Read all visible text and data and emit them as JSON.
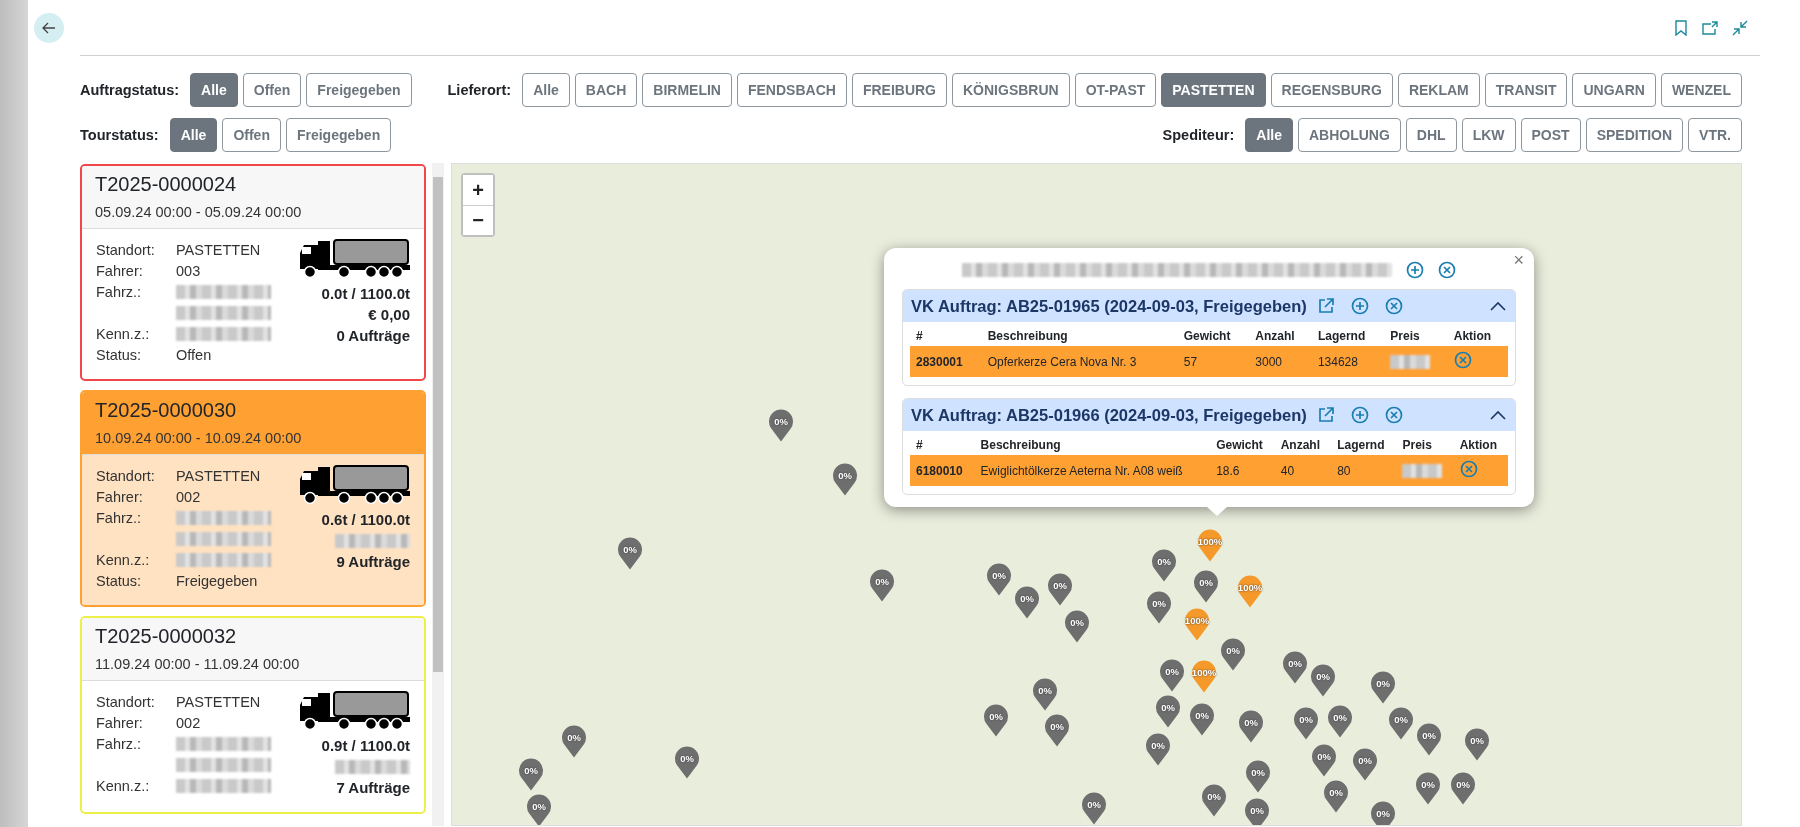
{
  "filter_rows": [
    {
      "groups": [
        {
          "label": "Auftragstatus:",
          "options": [
            {
              "label": "Alle",
              "selected": true
            },
            {
              "label": "Offen",
              "selected": false
            },
            {
              "label": "Freigegeben",
              "selected": false
            }
          ]
        },
        {
          "label": "Lieferort:",
          "options": [
            {
              "label": "Alle",
              "selected": false
            },
            {
              "label": "BACH",
              "selected": false
            },
            {
              "label": "BIRMELIN",
              "selected": false
            },
            {
              "label": "FENDSBACH",
              "selected": false
            },
            {
              "label": "FREIBURG",
              "selected": false
            },
            {
              "label": "KÖNIGSBRUN",
              "selected": false
            },
            {
              "label": "OT-PAST",
              "selected": false
            },
            {
              "label": "PASTETTEN",
              "selected": true
            },
            {
              "label": "REGENSBURG",
              "selected": false
            },
            {
              "label": "REKLAM",
              "selected": false
            },
            {
              "label": "TRANSIT",
              "selected": false
            },
            {
              "label": "UNGARN",
              "selected": false
            },
            {
              "label": "WENZEL",
              "selected": false
            }
          ]
        }
      ]
    },
    {
      "groups": [
        {
          "label": "Tourstatus:",
          "options": [
            {
              "label": "Alle",
              "selected": true
            },
            {
              "label": "Offen",
              "selected": false
            },
            {
              "label": "Freigegeben",
              "selected": false
            }
          ]
        },
        {
          "label": "Spediteur:",
          "options": [
            {
              "label": "Alle",
              "selected": true
            },
            {
              "label": "ABHOLUNG",
              "selected": false
            },
            {
              "label": "DHL",
              "selected": false
            },
            {
              "label": "LKW",
              "selected": false
            },
            {
              "label": "POST",
              "selected": false
            },
            {
              "label": "SPEDITION",
              "selected": false
            },
            {
              "label": "VTR.",
              "selected": false
            }
          ]
        }
      ]
    }
  ],
  "tours": [
    {
      "id": "T2025-0000024",
      "dates": "05.09.24 00:00 - 05.09.24 00:00",
      "color": "#f0474a",
      "selected": false,
      "fields": [
        {
          "label": "Standort:",
          "value": "PASTETTEN",
          "redacted": false
        },
        {
          "label": "Fahrer:",
          "value": "003",
          "redacted": false
        },
        {
          "label": "Fahrz.:",
          "redacted": true
        },
        {
          "redacted": true
        },
        {
          "label": "Kenn.z.:",
          "redacted": true
        },
        {
          "label": "Status:",
          "value": "Offen",
          "redacted": false
        }
      ],
      "summary": [
        {
          "text": "0.0t / 1100.0t",
          "redacted": false
        },
        {
          "text": "€ 0,00",
          "redacted": false
        },
        {
          "text": "0 Aufträge",
          "redacted": false
        }
      ]
    },
    {
      "id": "T2025-0000030",
      "dates": "10.09.24 00:00 - 10.09.24 00:00",
      "color": "#ffa033",
      "selected": true,
      "fields": [
        {
          "label": "Standort:",
          "value": "PASTETTEN",
          "redacted": false
        },
        {
          "label": "Fahrer:",
          "value": "002",
          "redacted": false
        },
        {
          "label": "Fahrz.:",
          "redacted": true
        },
        {
          "redacted": true
        },
        {
          "label": "Kenn.z.:",
          "redacted": true
        },
        {
          "label": "Status:",
          "value": "Freigegeben",
          "redacted": false
        }
      ],
      "summary": [
        {
          "text": "0.6t / 1100.0t",
          "redacted": false
        },
        {
          "redacted": true
        },
        {
          "text": "9 Aufträge",
          "redacted": false
        }
      ]
    },
    {
      "id": "T2025-0000032",
      "dates": "11.09.24 00:00 - 11.09.24 00:00",
      "color": "#eef04a",
      "selected": false,
      "fields": [
        {
          "label": "Standort:",
          "value": "PASTETTEN",
          "redacted": false
        },
        {
          "label": "Fahrer:",
          "value": "002",
          "redacted": false
        },
        {
          "label": "Fahrz.:",
          "redacted": true
        },
        {
          "redacted": true
        },
        {
          "label": "Kenn.z.:",
          "redacted": true
        }
      ],
      "summary": [
        {
          "text": "0.9t / 1100.0t",
          "redacted": false
        },
        {
          "redacted": true
        },
        {
          "text": "7 Aufträge",
          "redacted": false
        }
      ]
    }
  ],
  "map": {
    "zoom_controls": [
      "+",
      "−"
    ],
    "markers": [
      {
        "label": "0%",
        "kind": "empty"
      },
      {
        "label": "0%",
        "kind": "empty"
      },
      {
        "label": "0%",
        "kind": "empty"
      },
      {
        "label": "0%",
        "kind": "empty"
      },
      {
        "label": "0%",
        "kind": "empty"
      },
      {
        "label": "0%",
        "kind": "empty"
      },
      {
        "label": "0%",
        "kind": "empty"
      },
      {
        "label": "0%",
        "kind": "empty"
      },
      {
        "label": "0%",
        "kind": "empty"
      },
      {
        "label": "0%",
        "kind": "empty"
      },
      {
        "label": "0%",
        "kind": "empty"
      },
      {
        "label": "0%",
        "kind": "empty"
      },
      {
        "label": "0%",
        "kind": "empty"
      },
      {
        "label": "0%",
        "kind": "empty"
      },
      {
        "label": "0%",
        "kind": "empty"
      },
      {
        "label": "0%",
        "kind": "empty"
      },
      {
        "label": "0%",
        "kind": "empty"
      },
      {
        "label": "0%",
        "kind": "empty"
      },
      {
        "label": "0%",
        "kind": "empty"
      },
      {
        "label": "0%",
        "kind": "empty"
      },
      {
        "label": "0%",
        "kind": "empty"
      },
      {
        "label": "0%",
        "kind": "empty"
      },
      {
        "label": "0%",
        "kind": "empty"
      },
      {
        "label": "0%",
        "kind": "empty"
      },
      {
        "label": "0%",
        "kind": "empty"
      },
      {
        "label": "0%",
        "kind": "empty"
      },
      {
        "label": "0%",
        "kind": "empty"
      },
      {
        "label": "0%",
        "kind": "empty"
      },
      {
        "label": "0%",
        "kind": "empty"
      },
      {
        "label": "0%",
        "kind": "empty"
      },
      {
        "label": "0%",
        "kind": "empty"
      },
      {
        "label": "0%",
        "kind": "empty"
      },
      {
        "label": "0%",
        "kind": "empty"
      },
      {
        "label": "0%",
        "kind": "empty"
      },
      {
        "label": "0%",
        "kind": "empty"
      },
      {
        "label": "0%",
        "kind": "empty"
      },
      {
        "label": "0%",
        "kind": "empty"
      },
      {
        "label": "0%",
        "kind": "empty"
      },
      {
        "label": "0%",
        "kind": "empty"
      },
      {
        "label": "0%",
        "kind": "empty"
      },
      {
        "label": "0%",
        "kind": "empty"
      },
      {
        "label": "0%",
        "kind": "empty"
      },
      {
        "label": "100%",
        "kind": "full"
      },
      {
        "label": "100%",
        "kind": "full"
      },
      {
        "label": "100%",
        "kind": "full"
      },
      {
        "label": "100%",
        "kind": "full"
      }
    ],
    "popup": {
      "title": {
        "redacted": true
      },
      "close": "×",
      "orders": [
        {
          "title": "VK Auftrag: AB25-01965 (2024-09-03, Freigegeben)",
          "expanded": true,
          "columns": [
            "#",
            "Beschreibung",
            "Gewicht",
            "Anzahl",
            "Lagernd",
            "Preis",
            "Aktion"
          ],
          "rows": [
            {
              "cells": [
                {
                  "text": "2830001",
                  "redacted": false
                },
                {
                  "text": "Opferkerze Cera Nova Nr. 3",
                  "redacted": false
                },
                {
                  "text": "57",
                  "redacted": false
                },
                {
                  "text": "3000",
                  "redacted": false
                },
                {
                  "text": "134628",
                  "redacted": false
                },
                {
                  "redacted": true
                }
              ]
            }
          ]
        },
        {
          "title": "VK Auftrag: AB25-01966 (2024-09-03, Freigegeben)",
          "expanded": true,
          "columns": [
            "#",
            "Beschreibung",
            "Gewicht",
            "Anzahl",
            "Lagernd",
            "Preis",
            "Aktion"
          ],
          "rows": [
            {
              "cells": [
                {
                  "text": "6180010",
                  "redacted": false
                },
                {
                  "text": "Ewiglichtölkerze Aeterna Nr. A08 weiß",
                  "redacted": false
                },
                {
                  "text": "18.6",
                  "redacted": false
                },
                {
                  "text": "40",
                  "redacted": false
                },
                {
                  "text": "80",
                  "redacted": false
                },
                {
                  "redacted": true
                }
              ]
            }
          ]
        }
      ]
    }
  }
}
